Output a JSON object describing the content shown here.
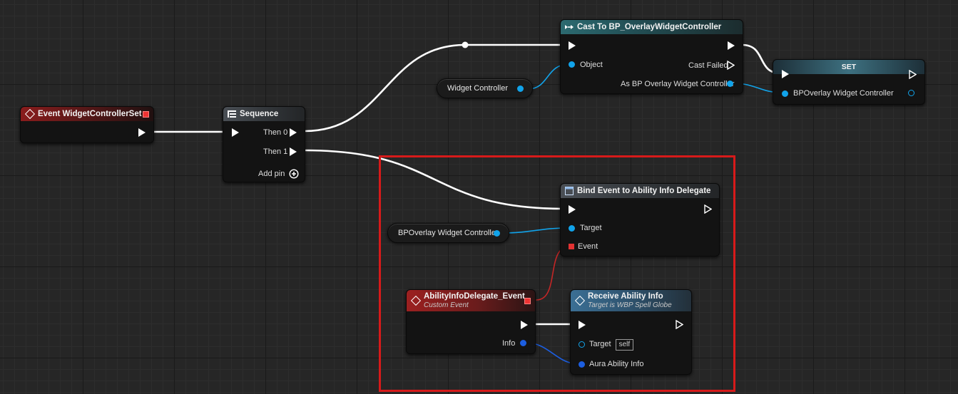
{
  "graph": {
    "event_node": {
      "title": "Event WidgetControllerSet"
    },
    "sequence_node": {
      "title": "Sequence",
      "pins": [
        "Then 0",
        "Then 1"
      ],
      "add_pin": "Add pin"
    },
    "cast_node": {
      "title": "Cast To BP_OverlayWidgetController",
      "input_pin": "Object",
      "cast_failed": "Cast Failed",
      "output_pin": "As BP Overlay Widget Controller"
    },
    "widget_controller_var": {
      "label": "Widget Controller"
    },
    "set_node": {
      "title": "SET",
      "pin": "BPOverlay Widget Controller"
    },
    "bpoverlay_var": {
      "label": "BPOverlay Widget Controller"
    },
    "bind_node": {
      "title": "Bind Event to Ability Info Delegate",
      "target": "Target",
      "event": "Event"
    },
    "custom_event_node": {
      "title": "AbilityInfoDelegate_Event",
      "subtitle": "Custom Event",
      "info_pin": "Info"
    },
    "receive_node": {
      "title": "Receive Ability Info",
      "subtitle": "Target is WBP Spell Globe",
      "target_pin": "Target",
      "target_default": "self",
      "aura_pin": "Aura Ability Info"
    }
  },
  "colors": {
    "exec_wire": "#ffffff",
    "object_pin": "#11a3ea",
    "struct_pin": "#1c5ee0",
    "delegate_pin": "#e33232",
    "highlight_box": "#d71a1a"
  },
  "icons": {
    "event": "event-diamond-icon",
    "sequence": "sequence-icon",
    "cast": "cast-icon",
    "bind": "function-icon"
  }
}
